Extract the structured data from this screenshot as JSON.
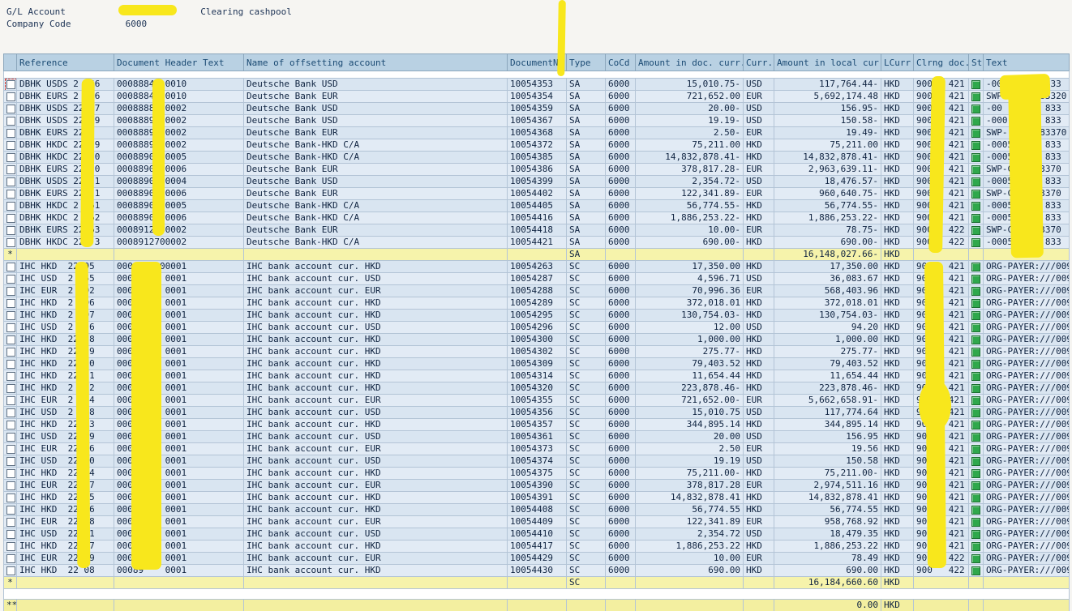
{
  "header": {
    "gl_account_label": "G/L Account",
    "gl_account_desc": "Clearing cashpool",
    "company_code_label": "Company Code",
    "company_code_value": "6000"
  },
  "colors": {
    "header_blue": "#b9d1e3",
    "row_blue": "#d9e5f1",
    "subtotal_yellow": "#f6f3ab",
    "redaction_yellow": "#f8e71c",
    "status_green": "#2fa84c"
  },
  "table": {
    "columns": [
      "Reference",
      "Document Header Text",
      "Name of offsetting account",
      "DocumentNo",
      "Type",
      "CoCd",
      "Amount in doc. curr.",
      "Curr.",
      "Amount in local cur.",
      "LCurr",
      "Clrng doc.",
      "St",
      "Text"
    ],
    "groups": [
      {
        "rows": [
          {
            "focused": true,
            "ref": "DBHK USDS 2  56",
            "dht": "0008884  0010",
            "name": "Deutsche Bank USD",
            "docno": "10054353",
            "type": "SA",
            "cocd": "6000",
            "amt_doc": "15,010.75-",
            "curr": "USD",
            "amt_loc": "117,764.44-",
            "lcurr": "HKD",
            "clrng": "9000  421",
            "text": "-000   5-0 833"
          },
          {
            "ref": "DBHK EURS 2   6",
            "dht": "0008884  0010",
            "name": "Deutsche Bank EUR",
            "docno": "10054354",
            "type": "SA",
            "cocd": "6000",
            "amt_doc": "721,652.00",
            "curr": "EUR",
            "amt_loc": "5,692,174.48",
            "lcurr": "HKD",
            "clrng": "9000  421",
            "text": "SWP-    8 83320"
          },
          {
            "ref": "DBHK USDS 22  7",
            "dht": "0008888  0002",
            "name": "Deutsche Bank USD",
            "docno": "10054359",
            "type": "SA",
            "cocd": "6000",
            "amt_doc": "20.00-",
            "curr": "USD",
            "amt_loc": "156.95-",
            "lcurr": "HKD",
            "clrng": "9000  421",
            "text": "-00    5-0 833"
          },
          {
            "ref": "DBHK USDS 22  9",
            "dht": "0008889 00002",
            "name": "Deutsche Bank USD",
            "docno": "10054367",
            "type": "SA",
            "cocd": "6000",
            "amt_doc": "19.19-",
            "curr": "USD",
            "amt_loc": "150.58-",
            "lcurr": "HKD",
            "clrng": "9000  421",
            "text": "-000   5-0 833"
          },
          {
            "ref": "DBHK EURS 22   ",
            "dht": "0008889 00002",
            "name": "Deutsche Bank EUR",
            "docno": "10054368",
            "type": "SA",
            "cocd": "6000",
            "amt_doc": "2.50-",
            "curr": "EUR",
            "amt_loc": "19.49-",
            "lcurr": "HKD",
            "clrng": "9000  421",
            "text": "SWP-    8 83370"
          },
          {
            "ref": "DBHK HKDC 22  9",
            "dht": "0008889 00002",
            "name": "Deutsche Bank-HKD C/A",
            "docno": "10054372",
            "type": "SA",
            "cocd": "6000",
            "amt_doc": "75,211.00",
            "curr": "HKD",
            "amt_loc": "75,211.00",
            "lcurr": "HKD",
            "clrng": "9000  421",
            "text": "-0005  0-0 833"
          },
          {
            "ref": "DBHK HKDC 22  0",
            "dht": "0008890 00005",
            "name": "Deutsche Bank-HKD C/A",
            "docno": "10054385",
            "type": "SA",
            "cocd": "6000",
            "amt_doc": "14,832,878.41-",
            "curr": "HKD",
            "amt_loc": "14,832,878.41-",
            "lcurr": "HKD",
            "clrng": "9000  421",
            "text": "-0005  0-0 833"
          },
          {
            "ref": "DBHK EURS 22  0",
            "dht": "0008890 00006",
            "name": "Deutsche Bank EUR",
            "docno": "10054386",
            "type": "SA",
            "cocd": "6000",
            "amt_doc": "378,817.28-",
            "curr": "EUR",
            "amt_loc": "2,963,639.11-",
            "lcurr": "HKD",
            "clrng": "9000  421",
            "text": "SWP-C    83370"
          },
          {
            "ref": "DBHK USDS 22  1",
            "dht": "0008890 00004",
            "name": "Deutsche Bank USD",
            "docno": "10054399",
            "type": "SA",
            "cocd": "6000",
            "amt_doc": "2,354.72-",
            "curr": "USD",
            "amt_loc": "18,476.57-",
            "lcurr": "HKD",
            "clrng": "9000  421",
            "text": "-0005   -0 833"
          },
          {
            "ref": "DBHK EURS 22  1",
            "dht": "0008890 00006",
            "name": "Deutsche Bank EUR",
            "docno": "10054402",
            "type": "SA",
            "cocd": "6000",
            "amt_doc": "122,341.89-",
            "curr": "EUR",
            "amt_loc": "960,640.75-",
            "lcurr": "HKD",
            "clrng": "9000  421",
            "text": "SWP-C    83370"
          },
          {
            "ref": "DBHK HKDC 2  61",
            "dht": "0008890 00005",
            "name": "Deutsche Bank-HKD C/A",
            "docno": "10054405",
            "type": "SA",
            "cocd": "6000",
            "amt_doc": "56,774.55-",
            "curr": "HKD",
            "amt_loc": "56,774.55-",
            "lcurr": "HKD",
            "clrng": "9000  421",
            "text": "-0005   -0 833"
          },
          {
            "ref": "DBHK HKDC 2  62",
            "dht": "0008890 00006",
            "name": "Deutsche Bank-HKD C/A",
            "docno": "10054416",
            "type": "SA",
            "cocd": "6000",
            "amt_doc": "1,886,253.22-",
            "curr": "HKD",
            "amt_loc": "1,886,253.22-",
            "lcurr": "HKD",
            "clrng": "9000  421",
            "text": "-0005   -0 833"
          },
          {
            "ref": "DBHK EURS 22 63",
            "dht": "0008912600002",
            "name": "Deutsche Bank EUR",
            "docno": "10054418",
            "type": "SA",
            "cocd": "6000",
            "amt_doc": "10.00-",
            "curr": "EUR",
            "amt_loc": "78.75-",
            "lcurr": "HKD",
            "clrng": "9000  422",
            "text": "SWP-C    83370"
          },
          {
            "ref": "DBHK HKDC 22  3",
            "dht": "0008912700002",
            "name": "Deutsche Bank-HKD C/A",
            "docno": "10054421",
            "type": "SA",
            "cocd": "6000",
            "amt_doc": "690.00-",
            "curr": "HKD",
            "amt_loc": "690.00-",
            "lcurr": "HKD",
            "clrng": "9000  422",
            "text": "-0005  0-0 833"
          }
        ],
        "subtotal": {
          "marker": "*",
          "type": "SA",
          "amount_local": "16,148,027.66-",
          "lcurr": "HKD"
        }
      },
      {
        "rows": [
          {
            "ref": "IHC HKD  22095",
            "dht": "0008822400001",
            "name": "IHC bank account cur. HKD",
            "docno": "10054263",
            "type": "SC",
            "cocd": "6000",
            "amt_doc": "17,350.00",
            "curr": "HKD",
            "amt_loc": "17,350.00",
            "lcurr": "HKD",
            "clrng": "900   421",
            "text": "ORG-PAYER:///009"
          },
          {
            "ref": "IHC USD  2  55",
            "dht": "00088    0001",
            "name": "IHC bank account cur. USD",
            "docno": "10054287",
            "type": "SC",
            "cocd": "6000",
            "amt_doc": "4,596.71",
            "curr": "USD",
            "amt_loc": "36,083.67",
            "lcurr": "HKD",
            "clrng": "900   421",
            "text": "ORG-PAYER:///009"
          },
          {
            "ref": "IHC EUR  2  92",
            "dht": "00088    0001",
            "name": "IHC bank account cur. EUR",
            "docno": "10054288",
            "type": "SC",
            "cocd": "6000",
            "amt_doc": "70,996.36",
            "curr": "EUR",
            "amt_loc": "568,403.96",
            "lcurr": "HKD",
            "clrng": "900   421",
            "text": "ORG-PAYER:///009"
          },
          {
            "ref": "IHC HKD  2 096",
            "dht": "00088    0001",
            "name": "IHC bank account cur. HKD",
            "docno": "10054289",
            "type": "SC",
            "cocd": "6000",
            "amt_doc": "372,018.01",
            "curr": "HKD",
            "amt_loc": "372,018.01",
            "lcurr": "HKD",
            "clrng": "900   421",
            "text": "ORG-PAYER:///009"
          },
          {
            "ref": "IHC HKD  2  97",
            "dht": "00088    0001",
            "name": "IHC bank account cur. HKD",
            "docno": "10054295",
            "type": "SC",
            "cocd": "6000",
            "amt_doc": "130,754.03-",
            "curr": "HKD",
            "amt_loc": "130,754.03-",
            "lcurr": "HKD",
            "clrng": "900   421",
            "text": "ORG-PAYER:///009"
          },
          {
            "ref": "IHC USD  2   6",
            "dht": "00088    0001",
            "name": "IHC bank account cur. USD",
            "docno": "10054296",
            "type": "SC",
            "cocd": "6000",
            "amt_doc": "12.00",
            "curr": "USD",
            "amt_loc": "94.20",
            "lcurr": "HKD",
            "clrng": "900   421",
            "text": "ORG-PAYER:///009"
          },
          {
            "ref": "IHC HKD  22  8",
            "dht": "00088    0001",
            "name": "IHC bank account cur. HKD",
            "docno": "10054300",
            "type": "SC",
            "cocd": "6000",
            "amt_doc": "1,000.00",
            "curr": "HKD",
            "amt_loc": "1,000.00",
            "lcurr": "HKD",
            "clrng": "900   421",
            "text": "ORG-PAYER:///009"
          },
          {
            "ref": "IHC HKD  22  9",
            "dht": "00088    0001",
            "name": "IHC bank account cur. HKD",
            "docno": "10054302",
            "type": "SC",
            "cocd": "6000",
            "amt_doc": "275.77-",
            "curr": "HKD",
            "amt_loc": "275.77-",
            "lcurr": "HKD",
            "clrng": "900   421",
            "text": "ORG-PAYER:///009"
          },
          {
            "ref": "IHC HKD  22  0",
            "dht": "00088    0001",
            "name": "IHC bank account cur. HKD",
            "docno": "10054309",
            "type": "SC",
            "cocd": "6000",
            "amt_doc": "79,403.52",
            "curr": "HKD",
            "amt_loc": "79,403.52",
            "lcurr": "HKD",
            "clrng": "900   421",
            "text": "ORG-PAYER:///009"
          },
          {
            "ref": "IHC HKD  22  1",
            "dht": "00088    0001",
            "name": "IHC bank account cur. HKD",
            "docno": "10054314",
            "type": "SC",
            "cocd": "6000",
            "amt_doc": "11,654.44",
            "curr": "HKD",
            "amt_loc": "11,654.44",
            "lcurr": "HKD",
            "clrng": "900   421",
            "text": "ORG-PAYER:///009"
          },
          {
            "ref": "IHC HKD  2  02",
            "dht": "00088    0001",
            "name": "IHC bank account cur. HKD",
            "docno": "10054320",
            "type": "SC",
            "cocd": "6000",
            "amt_doc": "223,878.46-",
            "curr": "HKD",
            "amt_loc": "223,878.46-",
            "lcurr": "HKD",
            "clrng": "900   421",
            "text": "ORG-PAYER:///009"
          },
          {
            "ref": "IHC EUR  2  94",
            "dht": "00088    0001",
            "name": "IHC bank account cur. EUR",
            "docno": "10054355",
            "type": "SC",
            "cocd": "6000",
            "amt_doc": "721,652.00-",
            "curr": "EUR",
            "amt_loc": "5,662,658.91-",
            "lcurr": "HKD",
            "clrng": "900   421",
            "text": "ORG-PAYER:///009"
          },
          {
            "ref": "IHC USD  2  58",
            "dht": "00088    0001",
            "name": "IHC bank account cur. USD",
            "docno": "10054356",
            "type": "SC",
            "cocd": "6000",
            "amt_doc": "15,010.75",
            "curr": "USD",
            "amt_loc": "117,774.64",
            "lcurr": "HKD",
            "clrng": "900   421",
            "text": "ORG-PAYER:///009"
          },
          {
            "ref": "IHC HKD  22  3",
            "dht": "00088    0001",
            "name": "IHC bank account cur. HKD",
            "docno": "10054357",
            "type": "SC",
            "cocd": "6000",
            "amt_doc": "344,895.14",
            "curr": "HKD",
            "amt_loc": "344,895.14",
            "lcurr": "HKD",
            "clrng": "900   421",
            "text": "ORG-PAYER:///009"
          },
          {
            "ref": "IHC USD  22  9",
            "dht": "00088    0001",
            "name": "IHC bank account cur. USD",
            "docno": "10054361",
            "type": "SC",
            "cocd": "6000",
            "amt_doc": "20.00",
            "curr": "USD",
            "amt_loc": "156.95",
            "lcurr": "HKD",
            "clrng": "900   421",
            "text": "ORG-PAYER:///009"
          },
          {
            "ref": "IHC EUR  22  6",
            "dht": "00088    0001",
            "name": "IHC bank account cur. EUR",
            "docno": "10054373",
            "type": "SC",
            "cocd": "6000",
            "amt_doc": "2.50",
            "curr": "EUR",
            "amt_loc": "19.56",
            "lcurr": "HKD",
            "clrng": "900   421",
            "text": "ORG-PAYER:///009"
          },
          {
            "ref": "IHC USD  22  0",
            "dht": "00088    0001",
            "name": "IHC bank account cur. USD",
            "docno": "10054374",
            "type": "SC",
            "cocd": "6000",
            "amt_doc": "19.19",
            "curr": "USD",
            "amt_loc": "150.58",
            "lcurr": "HKD",
            "clrng": "900   421",
            "text": "ORG-PAYER:///009"
          },
          {
            "ref": "IHC HKD  22 04",
            "dht": "00088    0001",
            "name": "IHC bank account cur. HKD",
            "docno": "10054375",
            "type": "SC",
            "cocd": "6000",
            "amt_doc": "75,211.00-",
            "curr": "HKD",
            "amt_loc": "75,211.00-",
            "lcurr": "HKD",
            "clrng": "900   421",
            "text": "ORG-PAYER:///009"
          },
          {
            "ref": "IHC EUR  22  7",
            "dht": "00089    0001",
            "name": "IHC bank account cur. EUR",
            "docno": "10054390",
            "type": "SC",
            "cocd": "6000",
            "amt_doc": "378,817.28",
            "curr": "EUR",
            "amt_loc": "2,974,511.16",
            "lcurr": "HKD",
            "clrng": "900   421",
            "text": "ORG-PAYER:///009"
          },
          {
            "ref": "IHC HKD  22  5",
            "dht": "00089    0001",
            "name": "IHC bank account cur. HKD",
            "docno": "10054391",
            "type": "SC",
            "cocd": "6000",
            "amt_doc": "14,832,878.41",
            "curr": "HKD",
            "amt_loc": "14,832,878.41",
            "lcurr": "HKD",
            "clrng": "900   421",
            "text": "ORG-PAYER:///009"
          },
          {
            "ref": "IHC HKD  22  6",
            "dht": "00089    0001",
            "name": "IHC bank account cur. HKD",
            "docno": "10054408",
            "type": "SC",
            "cocd": "6000",
            "amt_doc": "56,774.55",
            "curr": "HKD",
            "amt_loc": "56,774.55",
            "lcurr": "HKD",
            "clrng": "900   421",
            "text": "ORG-PAYER:///009"
          },
          {
            "ref": "IHC EUR  22  8",
            "dht": "00089    0001",
            "name": "IHC bank account cur. EUR",
            "docno": "10054409",
            "type": "SC",
            "cocd": "6000",
            "amt_doc": "122,341.89",
            "curr": "EUR",
            "amt_loc": "958,768.92",
            "lcurr": "HKD",
            "clrng": "900   421",
            "text": "ORG-PAYER:///009"
          },
          {
            "ref": "IHC USD  22  1",
            "dht": "00089    0001",
            "name": "IHC bank account cur. USD",
            "docno": "10054410",
            "type": "SC",
            "cocd": "6000",
            "amt_doc": "2,354.72",
            "curr": "USD",
            "amt_loc": "18,479.35",
            "lcurr": "HKD",
            "clrng": "900   421",
            "text": "ORG-PAYER:///009"
          },
          {
            "ref": "IHC HKD  22  7",
            "dht": "00089    0001",
            "name": "IHC bank account cur. HKD",
            "docno": "10054417",
            "type": "SC",
            "cocd": "6000",
            "amt_doc": "1,886,253.22",
            "curr": "HKD",
            "amt_loc": "1,886,253.22",
            "lcurr": "HKD",
            "clrng": "900   421",
            "text": "ORG-PAYER:///009"
          },
          {
            "ref": "IHC EUR  22  9",
            "dht": "00089    0001",
            "name": "IHC bank account cur. EUR",
            "docno": "10054429",
            "type": "SC",
            "cocd": "6000",
            "amt_doc": "10.00",
            "curr": "EUR",
            "amt_loc": "78.49",
            "lcurr": "HKD",
            "clrng": "900   422",
            "text": "ORG-PAYER:///009"
          },
          {
            "ref": "IHC HKD  22 08",
            "dht": "00089    0001",
            "name": "IHC bank account cur. HKD",
            "docno": "10054430",
            "type": "SC",
            "cocd": "6000",
            "amt_doc": "690.00",
            "curr": "HKD",
            "amt_loc": "690.00",
            "lcurr": "HKD",
            "clrng": "900   422",
            "text": "ORG-PAYER:///009"
          }
        ],
        "subtotal": {
          "marker": "*",
          "type": "SC",
          "amount_local": "16,184,660.60",
          "lcurr": "HKD"
        }
      }
    ],
    "grand_total": {
      "marker": "**",
      "amount_local": "0.00",
      "lcurr": "HKD"
    }
  }
}
